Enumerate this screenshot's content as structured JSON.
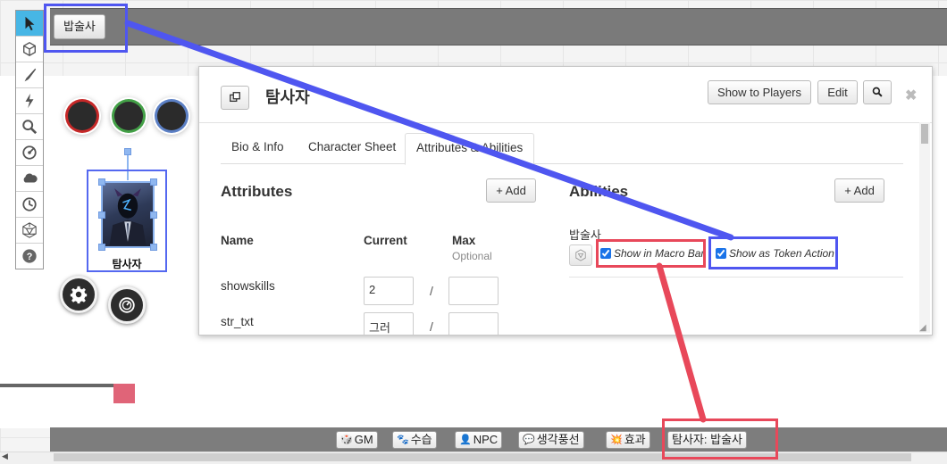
{
  "top_macro_bar": {
    "button_label": "밥술사"
  },
  "toolbar": {
    "tools": [
      "select-tool",
      "map-layer-tool",
      "drawing-tool",
      "fog-of-war-tool",
      "zoom-tool",
      "measure-tool",
      "dynamic-lighting-tool",
      "turn-tracker-tool",
      "dice-roller-tool",
      "help-tool"
    ],
    "active_tool": "select-tool"
  },
  "token": {
    "name": "탐사자",
    "aura_colors": [
      "#c62828",
      "#43a047",
      "#5b7fc4"
    ]
  },
  "dialog": {
    "title": "탐사자",
    "buttons": {
      "show_to_players": "Show to Players",
      "edit": "Edit"
    },
    "tabs": [
      "Bio & Info",
      "Character Sheet",
      "Attributes & Abilities"
    ],
    "active_tab": "Attributes & Abilities",
    "attributes": {
      "heading": "Attributes",
      "add_label": "+ Add",
      "col_name": "Name",
      "col_current": "Current",
      "col_max": "Max",
      "col_max_sub": "Optional",
      "rows": [
        {
          "name": "showskills",
          "current": "2",
          "max": ""
        },
        {
          "name": "str_txt",
          "current": "그러",
          "max": ""
        }
      ]
    },
    "abilities": {
      "heading": "Abilities",
      "add_label": "+ Add",
      "items": [
        {
          "name": "밥술사",
          "show_in_macro_bar": "Show in Macro Bar",
          "show_as_token_action": "Show as Token Action"
        }
      ]
    }
  },
  "bottom_bar": {
    "buttons": [
      {
        "icon": "🎲",
        "label": "GM"
      },
      {
        "icon": "🐾",
        "label": "수습"
      },
      {
        "icon": "👤",
        "label": "NPC"
      },
      {
        "icon": "💬",
        "label": "생각풍선"
      },
      {
        "icon": "💥",
        "label": "효과"
      },
      {
        "icon": "",
        "label": "탐사자: 밥술사"
      }
    ]
  },
  "colors": {
    "highlight_blue": "#4f56f0",
    "highlight_red": "#e8485a",
    "tool_active": "#47b6e5"
  }
}
